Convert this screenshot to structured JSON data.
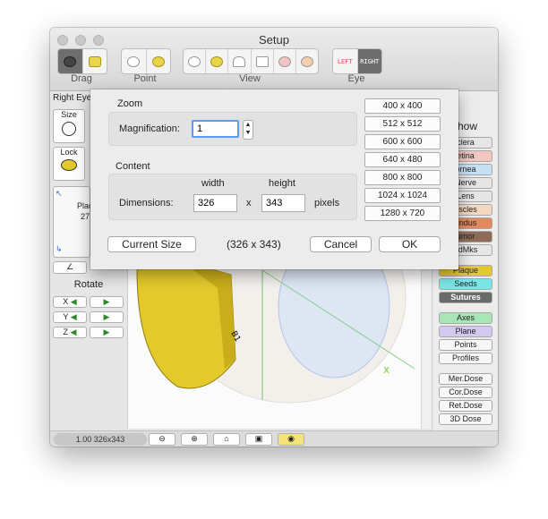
{
  "window": {
    "title": "Setup"
  },
  "toolbar": {
    "groups": [
      {
        "label": "Drag"
      },
      {
        "label": "Point"
      },
      {
        "label": "View"
      },
      {
        "label": "Eye"
      }
    ],
    "eye_left": "LEFT",
    "eye_right": "RIGHT"
  },
  "left_panel": {
    "right_eye_tab": "Right Eye",
    "size_label": "Size",
    "lock_label": "Lock",
    "view_text_1": "Plac",
    "view_text_2": "27",
    "rotate_label": "Rotate",
    "rotate_axes": [
      "X",
      "Y",
      "Z"
    ],
    "angle_icon_text": "&#8736;"
  },
  "right_panel": {
    "show_label": "how",
    "items": [
      {
        "label": "clera",
        "color": "#e6e6e6"
      },
      {
        "label": "etina",
        "color": "#f2c6c1"
      },
      {
        "label": "ornea",
        "color": "#c6dff2"
      },
      {
        "label": "Nerve",
        "color": "#e6e6e6"
      },
      {
        "label": "Lens",
        "color": "#e6e6e6"
      },
      {
        "label": "uscles",
        "color": "#f4d8c0"
      },
      {
        "label": "undus",
        "color": "#e2895f"
      },
      {
        "label": "umor",
        "color": "#8e6d58"
      },
      {
        "label": "ndMks",
        "color": "#e6e6e6"
      }
    ],
    "plaque": "Plaque",
    "seeds": "Seeds",
    "sutures": "Sutures",
    "axes": "Axes",
    "plane": "Plane",
    "points": "Points",
    "profiles": "Profiles",
    "mer_dose": "Mer.Dose",
    "cor_dose": "Cor.Dose",
    "ret_dose": "Ret.Dose",
    "dose_3d": "3D Dose"
  },
  "status": {
    "text": "1.00 326x343"
  },
  "dialog": {
    "zoom_title": "Zoom",
    "magnification_label": "Magnification:",
    "magnification_value": "1",
    "content_title": "Content",
    "width_header": "width",
    "height_header": "height",
    "dimensions_label": "Dimensions:",
    "width_value": "326",
    "times": "x",
    "height_value": "343",
    "pixels_label": "pixels",
    "current_size_button": "Current Size",
    "current_size_value": "(326 x 343)",
    "cancel_button": "Cancel",
    "ok_button": "OK",
    "size_presets": [
      "400 x 400",
      "512 x 512",
      "600 x 600",
      "640 x 480",
      "800 x 800",
      "1024 x 1024",
      "1280 x 720"
    ]
  },
  "colors": {
    "plaque": "#e3c92b",
    "seeds": "#7ae6e6",
    "sutures": "#6a6a6a",
    "axes": "#a8e6b8",
    "plane": "#d2c8f0",
    "accent": "#2a6fd6"
  }
}
